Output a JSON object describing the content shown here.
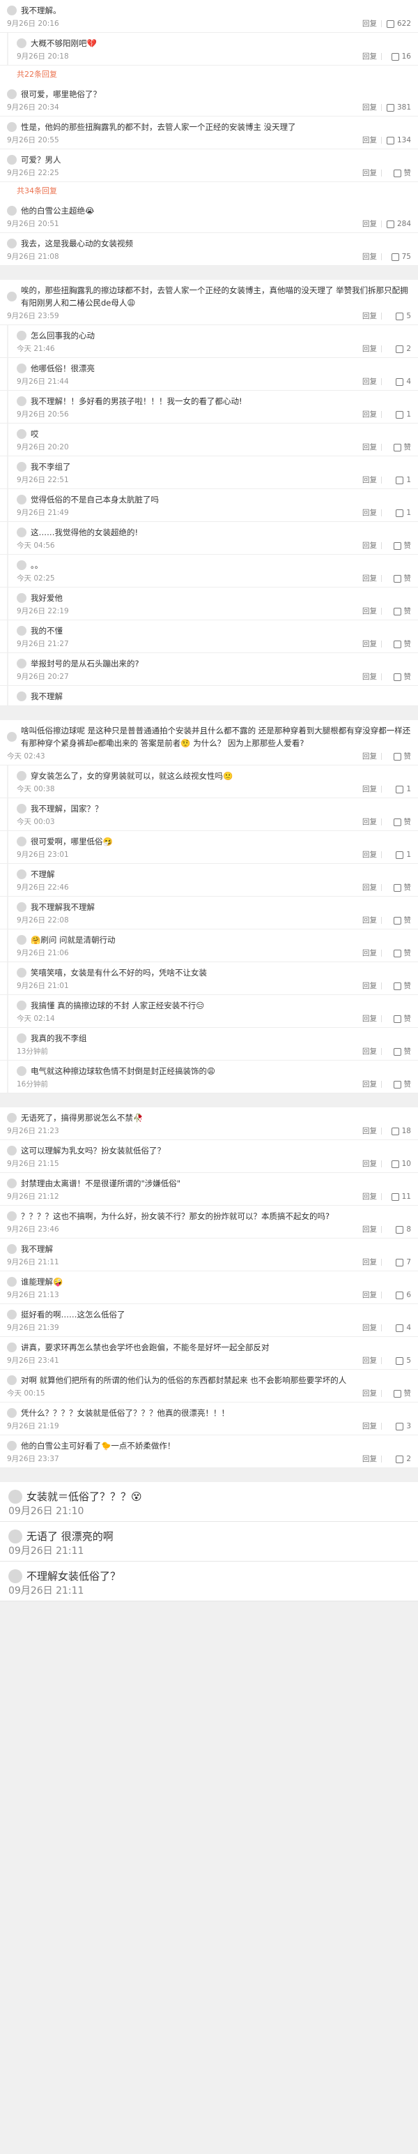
{
  "colors": {
    "accent": "#eb7350",
    "badge": "#f5b400",
    "gutter": "#f1f1f1"
  },
  "labels": {
    "reply": "回复",
    "like": "赞"
  },
  "cards": [
    {
      "rows": [
        {
          "sub": false,
          "text": "我不理解。",
          "time": "9月26日 20:16",
          "likes": "622"
        },
        {
          "sub": true,
          "text": "大概不够阳刚吧💔",
          "time": "9月26日 20:18",
          "likes": "16"
        },
        {
          "more": "共22条回复"
        },
        {
          "sub": false,
          "text": "很可爱，哪里艳俗了？",
          "time": "9月26日 20:34",
          "likes": "381"
        },
        {
          "sub": false,
          "text": "性是，他妈的那些扭胸露乳的都不封，去管人家一个正经的安装博主 没天理了",
          "time": "9月26日 20:55",
          "likes": "134"
        },
        {
          "sub": false,
          "text": "可爱？男人",
          "time": "9月26日 22:25",
          "likes": "赞"
        },
        {
          "more": "共34条回复"
        },
        {
          "sub": false,
          "text": "他的白雪公主超绝😭",
          "time": "9月26日 20:51",
          "likes": "284"
        },
        {
          "sub": false,
          "text": "我去，这是我最心动的女装视频",
          "time": "9月26日 21:08",
          "likes": "75"
        }
      ]
    },
    {
      "rows": [
        {
          "sub": false,
          "text": "唉的，那些扭胸露乳的擦边球都不封，去管人家一个正经的女装博主，真他喵的没天理了 举赞我们拆那只配拥有阳刚男人和二椿公民de母人😩",
          "time": "9月26日 23:59",
          "likes": "5"
        },
        {
          "sub": true,
          "text": "怎么回事我的心动",
          "time": "今天 21:46",
          "likes": "2"
        },
        {
          "sub": true,
          "text": "他哪低俗！很漂亮",
          "time": "9月26日 21:44",
          "likes": "4"
        },
        {
          "sub": true,
          "text": "我不理解！！多好看的男孩子啦！！！我一女的看了都心动!",
          "time": "9月26日 20:56",
          "likes": "1"
        },
        {
          "sub": true,
          "text": "哎",
          "time": "9月26日 20:20",
          "likes": "赞"
        },
        {
          "sub": true,
          "text": "我不李组了",
          "time": "9月26日 22:51",
          "likes": "1"
        },
        {
          "sub": true,
          "text": "觉得低俗的不是自己本身太肮脏了吗",
          "time": "9月26日 21:49",
          "likes": "1"
        },
        {
          "sub": true,
          "text": "这……我觉得他的女装超绝的!",
          "time": "今天 04:56",
          "likes": "赞"
        },
        {
          "sub": true,
          "text": "。。",
          "time": "今天 02:25",
          "likes": "赞"
        },
        {
          "sub": true,
          "text": "我好爱他",
          "time": "9月26日 22:19",
          "likes": "赞"
        },
        {
          "sub": true,
          "text": "我的不懂",
          "time": "9月26日 21:27",
          "likes": "赞"
        },
        {
          "sub": true,
          "text": "举报封号的是从石头蹦出来的?",
          "time": "9月26日 20:27",
          "likes": "赞"
        },
        {
          "sub": true,
          "text": "我不理解",
          "time": "",
          "likes": ""
        }
      ]
    },
    {
      "rows": [
        {
          "sub": false,
          "text": "啥叫低俗擦边球呢 是这种只是普普通通拍个安装并且什么都不露的 还是那种穿着到大腿根都有穿没穿都一样还有那种穿个紧身裤却e都嘞出来的 答案是前者🤨 为什么？ 因为上那那些人爱看?",
          "time": "今天 02:43",
          "likes": "赞"
        },
        {
          "sub": true,
          "text": "穿女装怎么了，女的穿男装就可以，就这么歧视女性吗🙁",
          "time": "今天 00:38",
          "likes": "1"
        },
        {
          "sub": true,
          "text": "我不理解，国家？？",
          "time": "今天 00:03",
          "likes": "赞"
        },
        {
          "sub": true,
          "text": "很可爱啊，哪里低俗🤧",
          "time": "9月26日 23:01",
          "likes": "1"
        },
        {
          "sub": true,
          "text": "不理解",
          "time": "9月26日 22:46",
          "likes": "赞"
        },
        {
          "sub": true,
          "text": "我不理解我不理解",
          "time": "9月26日 22:08",
          "likes": "赞"
        },
        {
          "sub": true,
          "text": "🤗刷问 问就是清朝行动",
          "time": "9月26日 21:06",
          "likes": "赞"
        },
        {
          "sub": true,
          "text": "笑嘻笑嘻，女装是有什么不好的吗，凭啥不让女装",
          "time": "9月26日 21:01",
          "likes": "赞"
        },
        {
          "sub": true,
          "text": "我搞懂 真的搞擦边球的不封 人家正经安装不行😑",
          "time": "今天 02:14",
          "likes": "赞"
        },
        {
          "sub": true,
          "text": "我真的我不李组",
          "time": "13分钟前",
          "likes": "赞"
        },
        {
          "sub": true,
          "text": "电气就这种擦边球软色情不封倒是封正经搞装饰的😩",
          "time": "16分钟前",
          "likes": "赞"
        }
      ]
    },
    {
      "rows": [
        {
          "sub": false,
          "text": "无语死了，搞得男那说怎么不禁🥀",
          "time": "9月26日 21:23",
          "likes": "18"
        },
        {
          "sub": false,
          "text": "这可以理解为乳女吗？扮女装就低俗了？",
          "time": "9月26日 21:15",
          "likes": "10"
        },
        {
          "sub": false,
          "text": "封禁理由太离谱！不是很谨所谓的\"涉嫌低俗\"",
          "time": "9月26日 21:12",
          "likes": "11"
        },
        {
          "sub": false,
          "text": "？？？？这也不搞啊，为什么好，扮女装不行？那女的扮炸就可以？本质搞不起女的吗?",
          "time": "9月26日 23:46",
          "likes": "8"
        },
        {
          "sub": false,
          "text": "我不理解",
          "time": "9月26日 21:11",
          "likes": "7"
        },
        {
          "sub": false,
          "text": "谁能理解🤪",
          "time": "9月26日 21:13",
          "likes": "6"
        },
        {
          "sub": false,
          "text": "挺好看的啊……这怎么低俗了",
          "time": "9月26日 21:39",
          "likes": "4"
        },
        {
          "sub": false,
          "text": "讲真，要求环再怎么禁也会学坏也会跑偏，不能冬是好坏一起全部反对",
          "time": "9月26日 23:41",
          "likes": "5"
        },
        {
          "sub": false,
          "text": "对啊 就算他们把所有的所谓的他们认为的低俗的东西都封禁起来 也不会影响那些要学坏的人",
          "time": "今天 00:15",
          "likes": "赞"
        },
        {
          "sub": false,
          "text": "凭什么？？？？女装就是低俗了？？？他真的很漂亮！！！",
          "time": "9月26日 21:19",
          "likes": "3"
        },
        {
          "sub": false,
          "text": "他的白雪公主可好看了🐤一点不娇柔做作！",
          "time": "9月26日 23:37",
          "likes": "2"
        }
      ]
    }
  ],
  "bottom": [
    {
      "text": "女装就＝低俗了？？？😵",
      "time": "09月26日 21:10"
    },
    {
      "text": "无语了 很漂亮的啊",
      "time": "09月26日 21:11"
    },
    {
      "text": "不理解女装低俗了？",
      "time": "09月26日 21:11"
    }
  ]
}
